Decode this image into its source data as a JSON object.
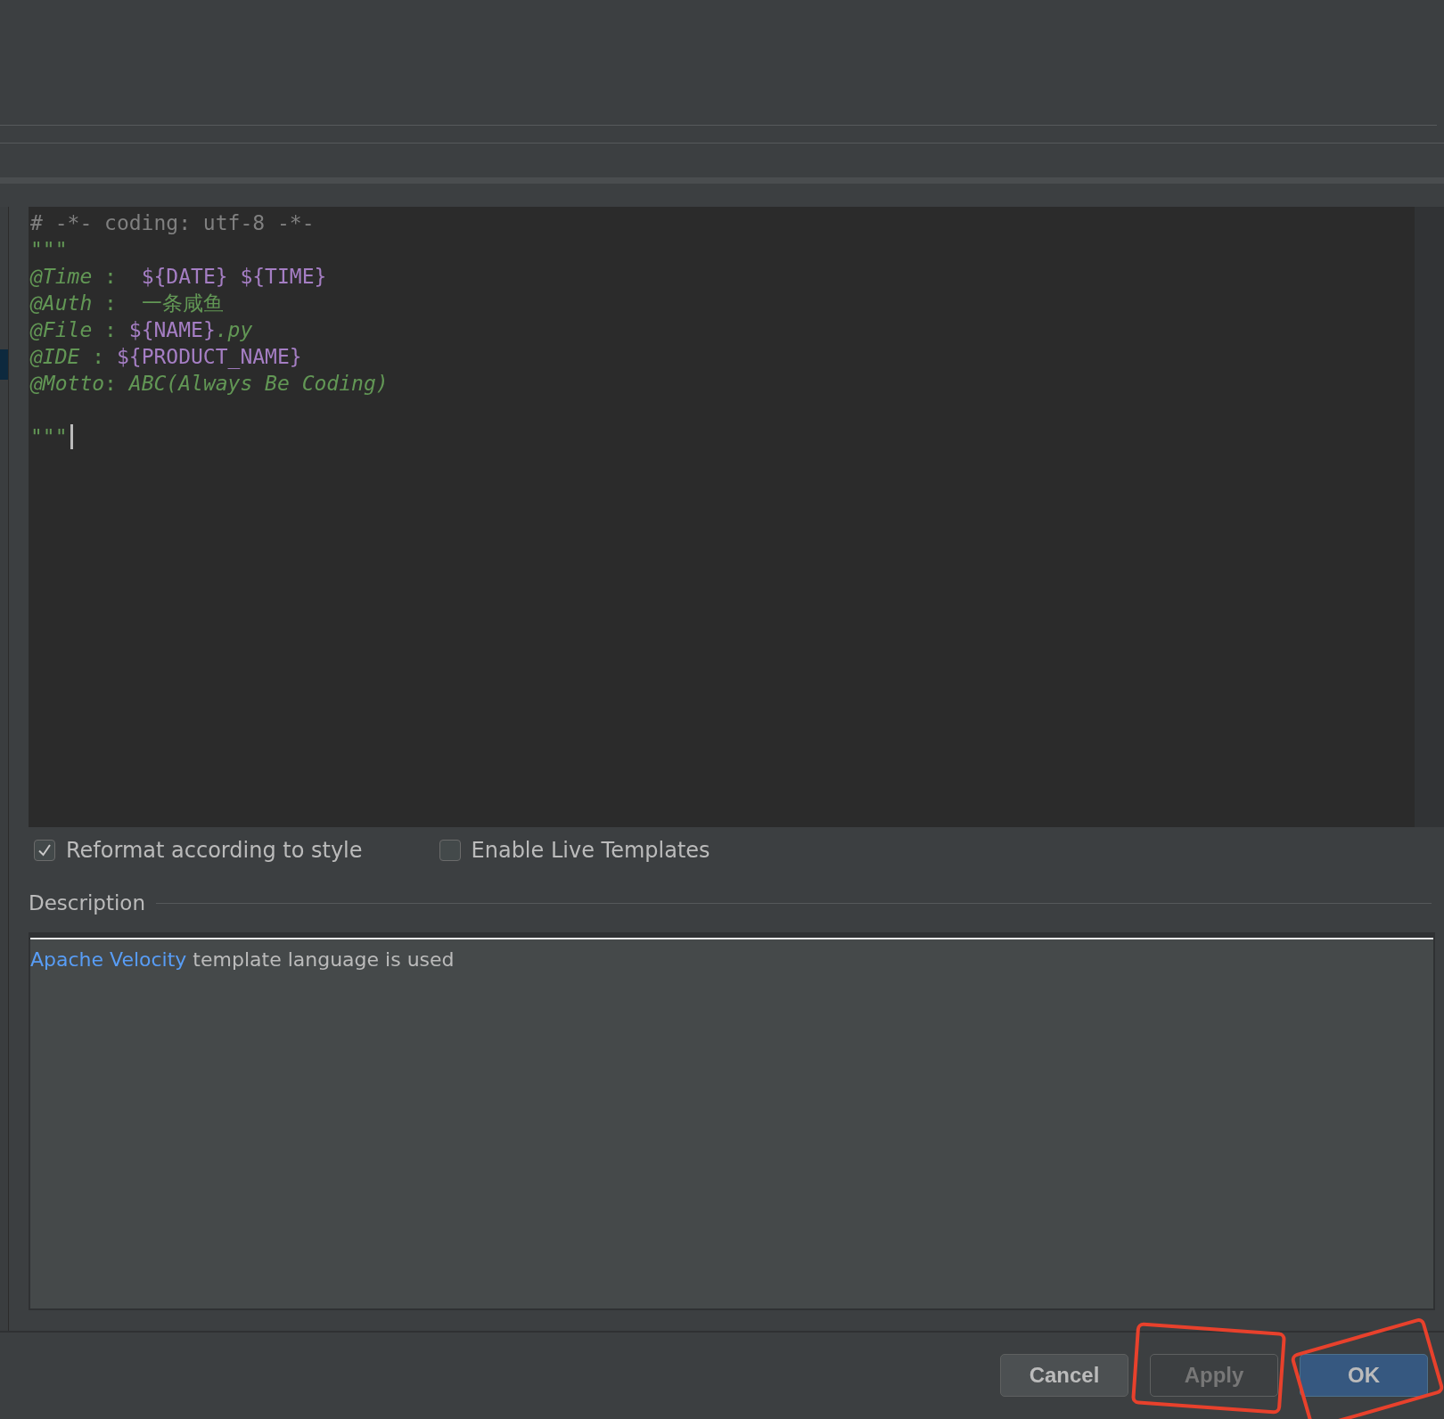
{
  "editor": {
    "lines": [
      {
        "segments": [
          {
            "text": "# -*- coding: utf-8 -*-",
            "kind": "comment"
          }
        ]
      },
      {
        "segments": [
          {
            "text": "\"\"\"",
            "kind": "string"
          }
        ]
      },
      {
        "segments": [
          {
            "text": "@Time",
            "kind": "tag"
          },
          {
            "text": " :  ",
            "kind": "string"
          },
          {
            "text": "${DATE} ${TIME}",
            "kind": "variable"
          }
        ]
      },
      {
        "segments": [
          {
            "text": "@Auth",
            "kind": "tag"
          },
          {
            "text": " :  一条咸鱼",
            "kind": "string"
          }
        ]
      },
      {
        "segments": [
          {
            "text": "@File",
            "kind": "tag"
          },
          {
            "text": " : ",
            "kind": "string"
          },
          {
            "text": "${NAME}",
            "kind": "variable"
          },
          {
            "text": ".py",
            "kind": "tag"
          }
        ]
      },
      {
        "segments": [
          {
            "text": "@IDE",
            "kind": "tag"
          },
          {
            "text": " : ",
            "kind": "string"
          },
          {
            "text": "${PRODUCT_NAME}",
            "kind": "variable"
          }
        ]
      },
      {
        "segments": [
          {
            "text": "@Motto",
            "kind": "tag"
          },
          {
            "text": ": ",
            "kind": "string"
          },
          {
            "text": "ABC(Always Be Coding)",
            "kind": "tag"
          }
        ]
      },
      {
        "segments": [
          {
            "text": "\"\"\"",
            "kind": "string"
          }
        ],
        "caret": true,
        "blank_before": true
      }
    ]
  },
  "options": [
    {
      "label": "Reformat according to style",
      "checked": true
    },
    {
      "label": "Enable Live Templates",
      "checked": false
    }
  ],
  "description": {
    "title": "Description",
    "link": "Apache Velocity",
    "text": " template language is used"
  },
  "buttons": [
    {
      "label": "Cancel",
      "kind": "normal",
      "highlighted": false
    },
    {
      "label": "Apply",
      "kind": "disabled",
      "highlighted": true
    },
    {
      "label": "OK",
      "kind": "default",
      "highlighted": true
    }
  ]
}
